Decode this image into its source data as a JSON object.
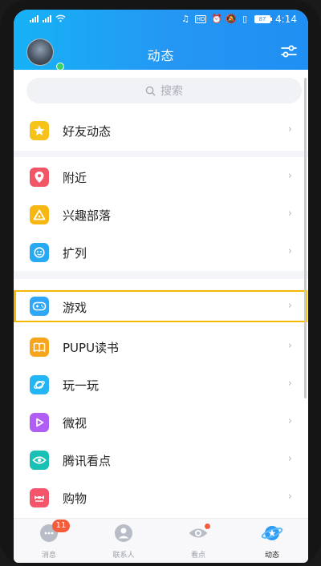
{
  "status_bar": {
    "time": "4:14",
    "battery": "87"
  },
  "header": {
    "title": "动态"
  },
  "search": {
    "placeholder": "搜索"
  },
  "items": [
    {
      "label": "好友动态",
      "icon": "star-icon",
      "color": "#f7c21a"
    },
    {
      "label": "附近",
      "icon": "location-pin-icon",
      "color": "#f25666"
    },
    {
      "label": "兴趣部落",
      "icon": "triangle-icon",
      "color": "#f7b713"
    },
    {
      "label": "扩列",
      "icon": "expand-icon",
      "color": "#27a9f4"
    },
    {
      "label": "游戏",
      "icon": "gamepad-icon",
      "color": "#2fa7f6"
    },
    {
      "label": "PUPU读书",
      "icon": "book-icon",
      "color": "#f6a51d"
    },
    {
      "label": "玩一玩",
      "icon": "planet-icon",
      "color": "#23b5f4"
    },
    {
      "label": "微视",
      "icon": "video-play-icon",
      "color": "#b05ef4"
    },
    {
      "label": "腾讯看点",
      "icon": "eye-icon",
      "color": "#19c1b4"
    },
    {
      "label": "购物",
      "icon": "shopping-bag-icon",
      "color": "#f5556a"
    }
  ],
  "bottom_nav": [
    {
      "label": "消息",
      "icon": "message-icon",
      "badge": "11"
    },
    {
      "label": "联系人",
      "icon": "contacts-icon"
    },
    {
      "label": "看点",
      "icon": "eye-icon"
    },
    {
      "label": "动态",
      "icon": "planet-icon"
    }
  ],
  "colors": {
    "header_start": "#16b2f6",
    "header_end": "#1f8ff3",
    "highlight": "#f5b800",
    "badge": "#f45c3c"
  }
}
